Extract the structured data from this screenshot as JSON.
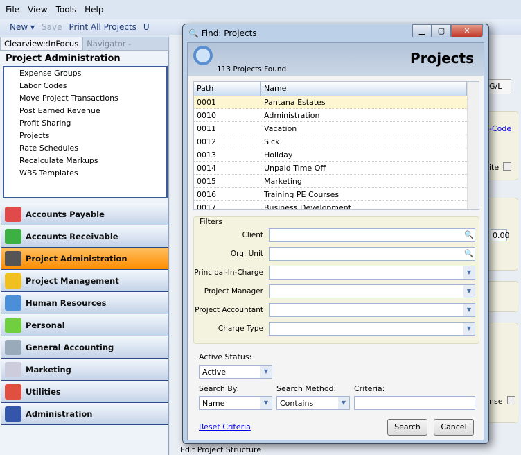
{
  "menu": [
    "File",
    "View",
    "Tools",
    "Help"
  ],
  "toolbar": {
    "new": "New ▾",
    "save": "Save",
    "print": "Print All Projects",
    "partial": "U"
  },
  "tabs": [
    "Clearview::InFocus",
    "Navigator  - Projects"
  ],
  "left": {
    "heading": "Project Administration",
    "items": [
      "Expense Groups",
      "Labor Codes",
      "Move Project Transactions",
      "Post Earned Revenue",
      "Profit Sharing",
      "Projects",
      "Rate Schedules",
      "Recalculate Markups",
      "WBS Templates"
    ],
    "nav": [
      {
        "label": "Accounts Payable",
        "color": "#e04a4a"
      },
      {
        "label": "Accounts Receivable",
        "color": "#3cb043"
      },
      {
        "label": "Project Administration",
        "color": "#555"
      },
      {
        "label": "Project Management",
        "color": "#f0c020"
      },
      {
        "label": "Human Resources",
        "color": "#4a8fd8"
      },
      {
        "label": "Personal",
        "color": "#6fcf3f"
      },
      {
        "label": "General Accounting",
        "color": "#9ab"
      },
      {
        "label": "Marketing",
        "color": "#ccd"
      },
      {
        "label": "Utilities",
        "color": "#e05040"
      },
      {
        "label": "Administration",
        "color": "#3355aa"
      }
    ],
    "selected": "Project Administration"
  },
  "background": {
    "tab_gl": "G/L",
    "link": "-Code",
    "ite": "ite",
    "amount": "0.00",
    "nse": "nse",
    "edit_structure": "Edit Project Structure"
  },
  "dialog": {
    "title": "Find: Projects",
    "header": "Projects",
    "count": "113 Projects Found",
    "columns": [
      "Path",
      "Name"
    ],
    "rows": [
      [
        "0001",
        "Pantana Estates"
      ],
      [
        "0010",
        "Administration"
      ],
      [
        "0011",
        "Vacation"
      ],
      [
        "0012",
        "Sick"
      ],
      [
        "0013",
        "Holiday"
      ],
      [
        "0014",
        "Unpaid Time Off"
      ],
      [
        "0015",
        "Marketing"
      ],
      [
        "0016",
        "Training PE Courses"
      ],
      [
        "0017",
        "Business Development"
      ]
    ],
    "filters_label": "Filters",
    "filters": [
      "Client",
      "Org. Unit",
      "Principal-In-Charge",
      "Project Manager",
      "Project Accountant",
      "Charge Type"
    ],
    "active_status_label": "Active Status:",
    "active_status": "Active",
    "search_by_label": "Search By:",
    "search_by": "Name",
    "search_method_label": "Search Method:",
    "search_method": "Contains",
    "criteria_label": "Criteria:",
    "criteria": "",
    "reset": "Reset Criteria",
    "search": "Search",
    "cancel": "Cancel"
  }
}
